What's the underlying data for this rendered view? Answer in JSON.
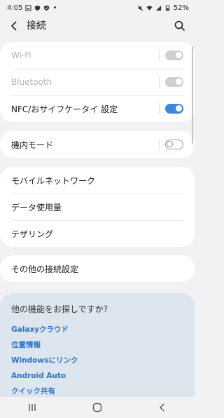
{
  "status_bar": {
    "time": "4:05",
    "dot": "•",
    "battery": "52%"
  },
  "header": {
    "title": "接続"
  },
  "groups": [
    {
      "rows": [
        {
          "label": "Wi-Fi",
          "toggle": "on",
          "disabled": true
        },
        {
          "label": "Bluetooth",
          "toggle": "on",
          "disabled": true
        },
        {
          "label": "NFC/おサイフケータイ 設定",
          "toggle": "on",
          "disabled": false
        }
      ]
    },
    {
      "rows": [
        {
          "label": "機内モード",
          "toggle": "off",
          "disabled": false
        }
      ]
    },
    {
      "rows": [
        {
          "label": "モバイルネットワーク"
        },
        {
          "label": "データ使用量"
        },
        {
          "label": "テザリング"
        }
      ]
    },
    {
      "rows": [
        {
          "label": "その他の接続設定"
        }
      ]
    }
  ],
  "suggestions": {
    "title": "他の機能をお探しですか？",
    "links": [
      "Galaxyクラウド",
      "位置情報",
      "Windowsにリンク",
      "Android Auto",
      "クイック共有"
    ]
  },
  "colors": {
    "accent": "#3e84e0",
    "link": "#2a73c8",
    "suggest_bg": "#dde6ee"
  }
}
